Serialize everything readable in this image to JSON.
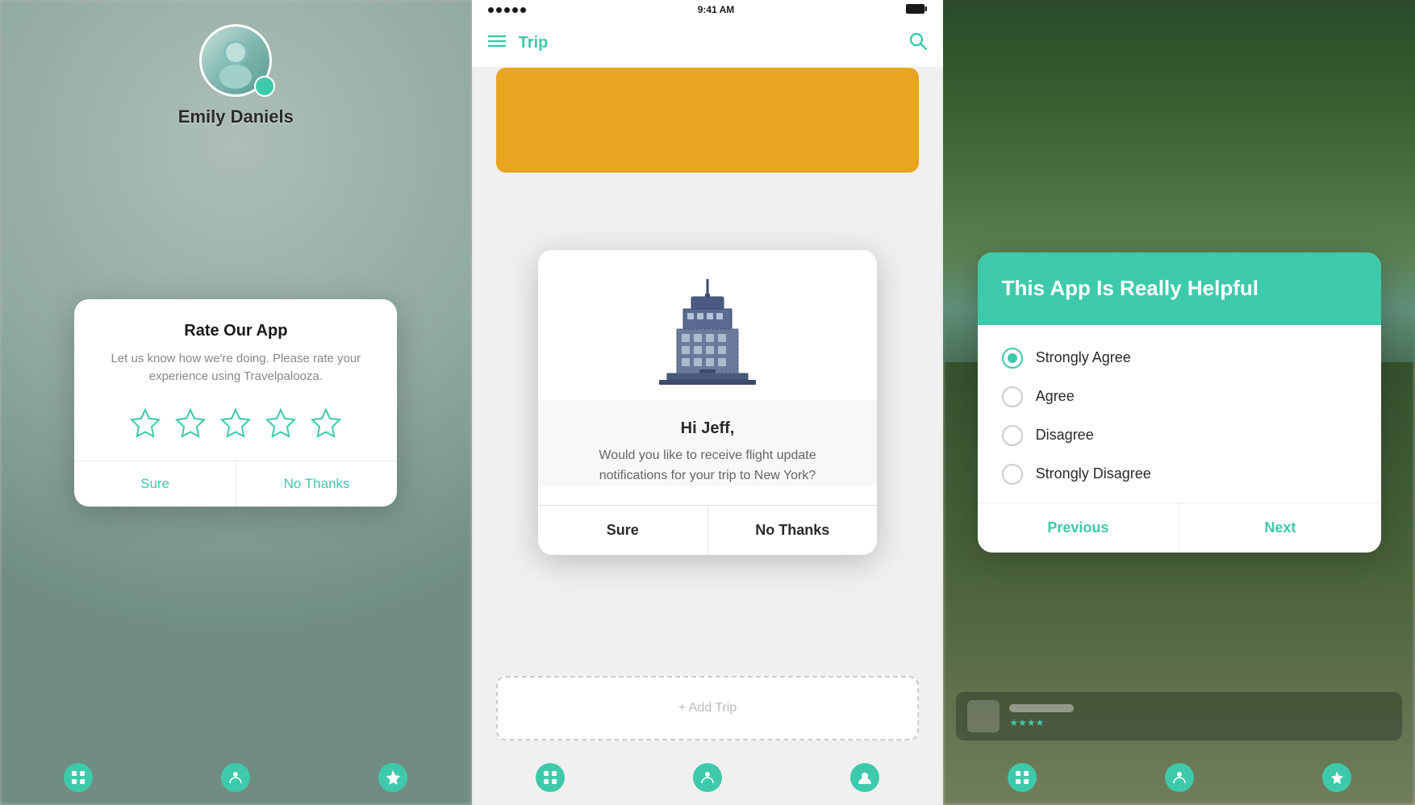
{
  "panels": {
    "left": {
      "profile": {
        "name": "Emily Daniels"
      },
      "dialog": {
        "title": "Rate Our App",
        "subtitle": "Let us know how we're doing. Please rate your experience using Travelpalooza.",
        "stars_count": 5,
        "btn_sure": "Sure",
        "btn_no_thanks": "No Thanks"
      }
    },
    "center": {
      "status_bar": {
        "dots_label": "signal",
        "time": "9:41 AM",
        "battery": "battery"
      },
      "app_bar": {
        "menu_label": "menu",
        "title": "Trip",
        "search_label": "search"
      },
      "dialog": {
        "greeting": "Hi Jeff,",
        "message": "Would you like to receive flight update notifications for your trip to New York?",
        "btn_sure": "Sure",
        "btn_no_thanks": "No Thanks"
      },
      "add_trip": "+ Add Trip"
    },
    "right": {
      "dialog": {
        "header_title": "This App Is Really Helpful",
        "options": [
          {
            "label": "Strongly Agree",
            "selected": true
          },
          {
            "label": "Agree",
            "selected": false
          },
          {
            "label": "Disagree",
            "selected": false
          },
          {
            "label": "Strongly Disagree",
            "selected": false
          }
        ],
        "btn_previous": "Previous",
        "btn_next": "Next"
      }
    }
  },
  "colors": {
    "accent": "#3ecaaa",
    "dark_text": "#1a1a1a",
    "medium_text": "#666666",
    "light_border": "#ebebeb"
  }
}
